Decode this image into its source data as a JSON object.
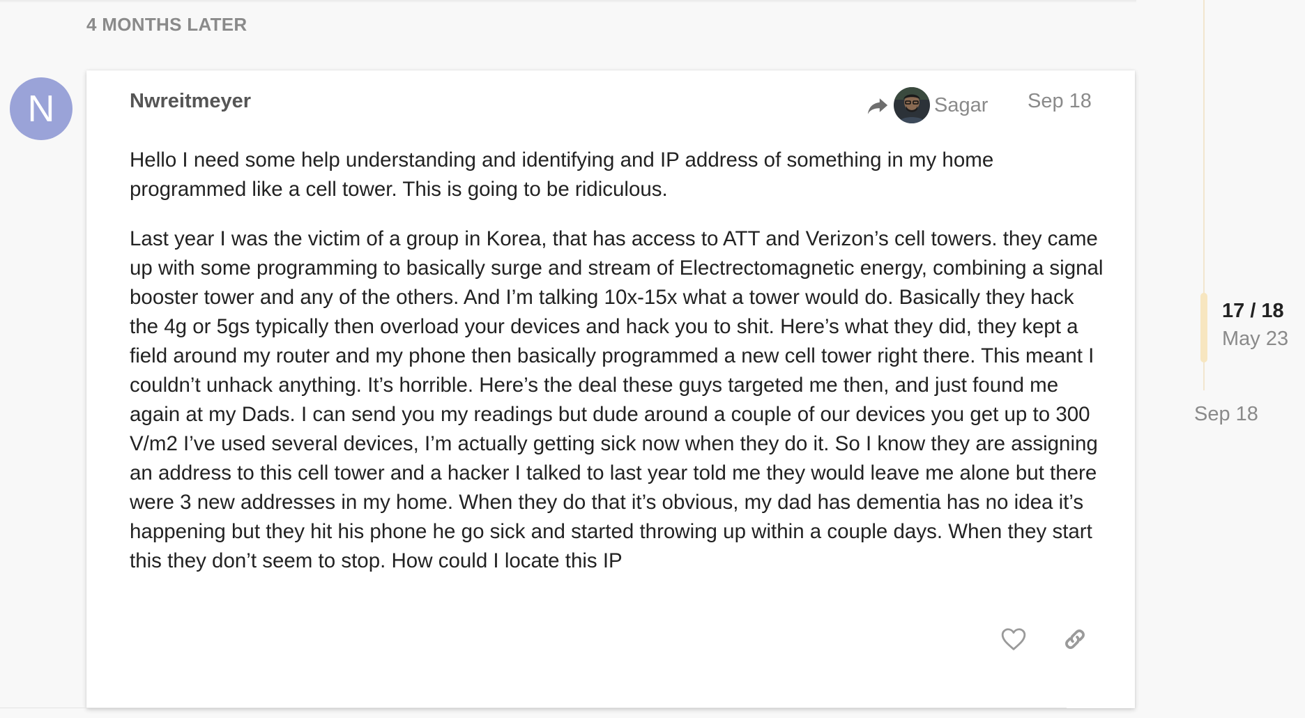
{
  "time_gap": "4 MONTHS LATER",
  "post": {
    "avatar_letter": "N",
    "avatar_color": "#9aa3d8",
    "username": "Nwreitmeyer",
    "reply_to_name": "Sagar",
    "date": "Sep 18",
    "paragraphs": [
      "Hello I need some help understanding and identifying and IP address of something in my home programmed like a cell tower. This is going to be ridiculous.",
      "Last year I was the victim of a group in Korea, that has access to ATT and Verizon’s cell towers. they came up with some programming to basically surge and stream of Electrectomagnetic energy, combining a signal booster tower and any of the others. And I’m talking 10x-15x what a tower would do. Basically they hack the 4g or 5gs typically then overload your devices and hack you to shit. Here’s what they did, they kept a field around my router and my phone then basically programmed a new cell tower right there. This meant I couldn’t unhack anything. It’s horrible. Here’s the deal these guys targeted me then, and just found me again at my Dads. I can send you my readings but dude around a couple of our devices you get up to 300 V/m2 I’ve used several devices, I’m actually getting sick now when they do it. So I know they are assigning an address to this cell tower and a hacker I talked to last year told me they would leave me alone but there were 3 new addresses in my home. When they do that it’s obvious, my dad has dementia has no idea it’s happening but they hit his phone he go sick and started throwing up within a couple days. When they start this they don’t seem to stop. How could I locate this IP"
    ],
    "actions": {
      "like_icon": "heart-icon",
      "share_icon": "link-icon"
    }
  },
  "timeline": {
    "position": "17 / 18",
    "position_date": "May 23",
    "end_date": "Sep 18",
    "accent_color": "#f7e6c0"
  }
}
